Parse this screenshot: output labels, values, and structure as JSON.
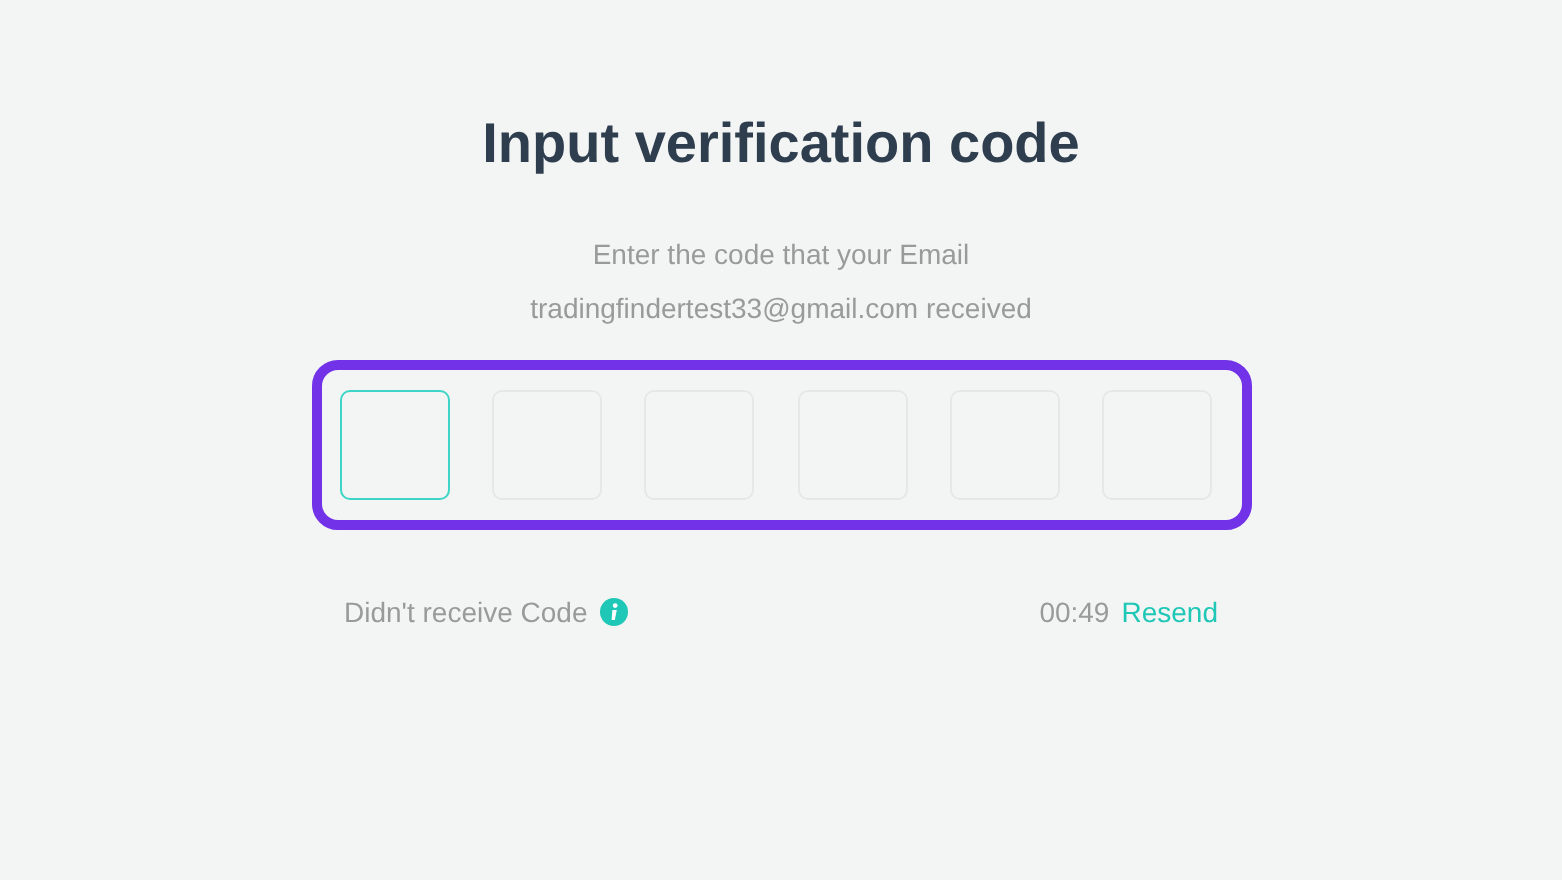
{
  "title": "Input verification code",
  "instructions": [
    "Enter the code that your Email",
    "tradingfindertest33@gmail.com received"
  ],
  "code_fields": {
    "highlighted": true,
    "boxes": [
      {
        "selected": true
      },
      {
        "selected": false
      },
      {
        "selected": false
      },
      {
        "selected": false
      },
      {
        "selected": false
      },
      {
        "selected": false
      }
    ]
  },
  "footer": {
    "help_text": "Didn't receive Code",
    "timer": "00:49",
    "resend_link": "Resend"
  }
}
